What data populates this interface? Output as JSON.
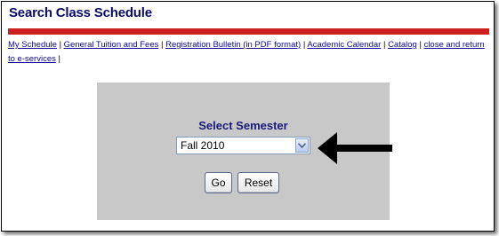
{
  "page": {
    "title": "Search Class Schedule"
  },
  "nav": {
    "links": [
      {
        "label": "My Schedule"
      },
      {
        "label": "General Tuition and Fees"
      },
      {
        "label": "Registration Bulletin (in PDF format)"
      },
      {
        "label": "Academic Calendar"
      },
      {
        "label": "Catalog"
      },
      {
        "label": "close and return to e-services"
      }
    ],
    "separator": "|"
  },
  "semester_panel": {
    "heading": "Select Semester",
    "selected_value": "Fall 2010",
    "go_label": "Go",
    "reset_label": "Reset"
  },
  "colors": {
    "title": "#0b0b66",
    "red_bar": "#cc1f1f",
    "panel_bg": "#c8c8c8",
    "link": "#0b0b99"
  },
  "icons": {
    "dropdown": "chevron-down-icon",
    "annotation": "arrow-left-icon"
  }
}
